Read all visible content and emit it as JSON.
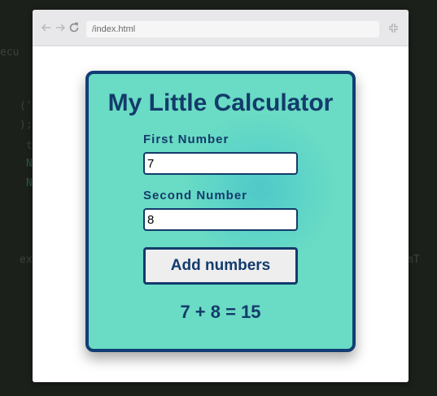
{
  "browser": {
    "address": "/index.html"
  },
  "calculator": {
    "title": "My Little Calculator",
    "first_label": "First Number",
    "first_value": "7",
    "second_label": "Second Number",
    "second_value": "8",
    "button_label": "Add numbers",
    "result": "7 + 8 = 15"
  },
  "colors": {
    "card_background": "#6adbc4",
    "card_border": "#123d74",
    "text": "#133b6b",
    "page_background": "#1c201b"
  },
  "icons": [
    "back-arrow-icon",
    "forward-arrow-icon",
    "reload-icon",
    "collapse-icon"
  ]
}
